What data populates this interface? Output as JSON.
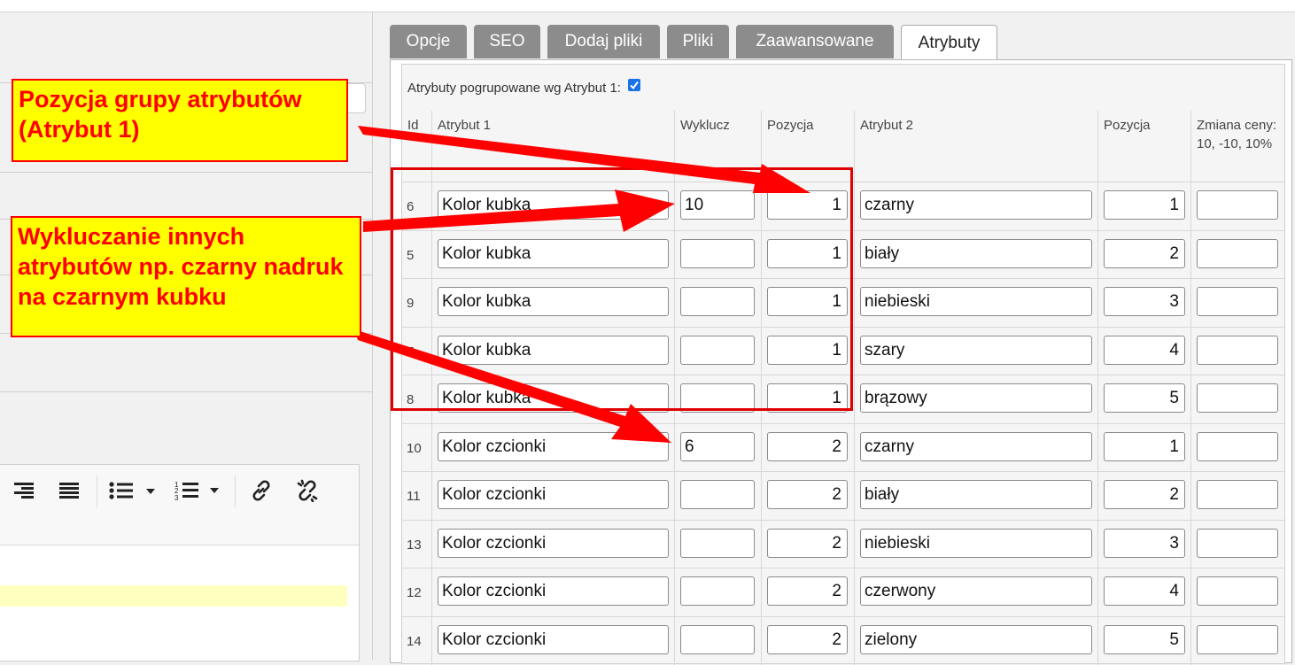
{
  "tabs": [
    "Opcje",
    "SEO",
    "Dodaj pliki",
    "Pliki",
    "Zaawansowane",
    "Atrybuty"
  ],
  "active_tab": "Atrybuty",
  "grouped_label": "Atrybuty pogrupowane wg Atrybut 1:",
  "grouped_checked": true,
  "headers": {
    "id": "Id",
    "attr1": "Atrybut 1",
    "exclude": "Wyklucz",
    "pos1": "Pozycja",
    "attr2": "Atrybut 2",
    "pos2": "Pozycja",
    "price": "Zmiana ceny: 10, -10, 10%"
  },
  "rows": [
    {
      "id": "6",
      "attr1": "Kolor kubka",
      "exclude": "10",
      "pos1": "1",
      "attr2": "czarny",
      "pos2": "1",
      "price": ""
    },
    {
      "id": "5",
      "attr1": "Kolor kubka",
      "exclude": "",
      "pos1": "1",
      "attr2": "biały",
      "pos2": "2",
      "price": ""
    },
    {
      "id": "9",
      "attr1": "Kolor kubka",
      "exclude": "",
      "pos1": "1",
      "attr2": "niebieski",
      "pos2": "3",
      "price": ""
    },
    {
      "id": "7",
      "attr1": "Kolor kubka",
      "exclude": "",
      "pos1": "1",
      "attr2": "szary",
      "pos2": "4",
      "price": ""
    },
    {
      "id": "8",
      "attr1": "Kolor kubka",
      "exclude": "",
      "pos1": "1",
      "attr2": "brązowy",
      "pos2": "5",
      "price": ""
    },
    {
      "id": "10",
      "attr1": "Kolor czcionki",
      "exclude": "6",
      "pos1": "2",
      "attr2": "czarny",
      "pos2": "1",
      "price": ""
    },
    {
      "id": "11",
      "attr1": "Kolor czcionki",
      "exclude": "",
      "pos1": "2",
      "attr2": "biały",
      "pos2": "2",
      "price": ""
    },
    {
      "id": "13",
      "attr1": "Kolor czcionki",
      "exclude": "",
      "pos1": "2",
      "attr2": "niebieski",
      "pos2": "3",
      "price": ""
    },
    {
      "id": "12",
      "attr1": "Kolor czcionki",
      "exclude": "",
      "pos1": "2",
      "attr2": "czerwony",
      "pos2": "4",
      "price": ""
    },
    {
      "id": "14",
      "attr1": "Kolor czcionki",
      "exclude": "",
      "pos1": "2",
      "attr2": "zielony",
      "pos2": "5",
      "price": ""
    }
  ],
  "annotations": {
    "group_position": "Pozycja grupy atrybutów (Atrybut 1)",
    "exclude_note": "Wykluczanie innych atrybutów np. czarny nadruk na czarnym kubku"
  },
  "toolbar_icons": [
    "align-right-icon",
    "align-justify-icon",
    "bullet-list-icon",
    "numbered-list-icon",
    "link-icon",
    "unlink-icon"
  ],
  "colors": {
    "annotation_bg": "#ffff00",
    "annotation_text": "#ff0000",
    "tab_inactive": "#8c8c8c",
    "checkbox": "#1a73e8"
  }
}
